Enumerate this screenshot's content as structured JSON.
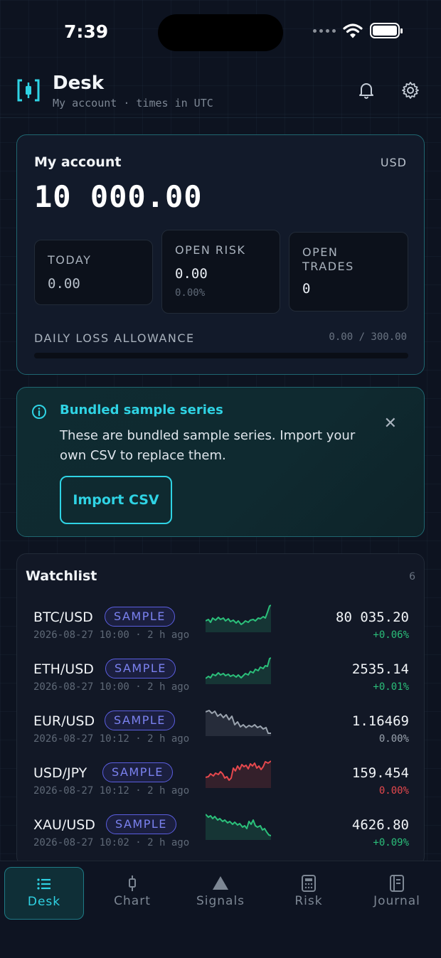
{
  "status_bar": {
    "time": "7:39"
  },
  "header": {
    "title": "Desk",
    "subtitle": "My account · times in UTC",
    "icons": [
      "bell-icon",
      "gear-icon"
    ]
  },
  "account": {
    "title": "My account",
    "currency": "USD",
    "balance": "10 000.00",
    "today": {
      "label": "TODAY",
      "value": "0.00"
    },
    "open_risk": {
      "label": "OPEN RISK",
      "value": "0.00",
      "sub": "0.00%"
    },
    "open_trades": {
      "label": "OPEN TRADES",
      "value": "0"
    },
    "daily_loss": {
      "label": "DAILY LOSS ALLOWANCE",
      "value": "0.00 / 300.00",
      "used_fraction": 0
    }
  },
  "banner": {
    "title": "Bundled sample series",
    "text": "These are bundled sample series. Import your own CSV to replace them.",
    "button": "Import CSV",
    "close": "✕"
  },
  "watchlist": {
    "title": "Watchlist",
    "count": "6",
    "badge": "SAMPLE",
    "items": [
      {
        "symbol": "BTC/USD",
        "timestamp": "2026-08-27 10:00 · 2 h ago",
        "price": "80 035.20",
        "change": "+0.06%",
        "direction": "up"
      },
      {
        "symbol": "ETH/USD",
        "timestamp": "2026-08-27 10:00 · 2 h ago",
        "price": "2535.14",
        "change": "+0.01%",
        "direction": "up"
      },
      {
        "symbol": "EUR/USD",
        "timestamp": "2026-08-27 10:12 · 2 h ago",
        "price": "1.16469",
        "change": "0.00%",
        "direction": "flat"
      },
      {
        "symbol": "USD/JPY",
        "timestamp": "2026-08-27 10:12 · 2 h ago",
        "price": "159.454",
        "change": "0.00%",
        "direction": "down"
      },
      {
        "symbol": "XAU/USD",
        "timestamp": "2026-08-27 10:02 · 2 h ago",
        "price": "4626.80",
        "change": "+0.09%",
        "direction": "up"
      }
    ]
  },
  "colors": {
    "accent": "#2fd3e4",
    "up": "#2bbf7a",
    "down": "#e5484d",
    "flat": "#9aa3ae",
    "badge": "#7b82f0"
  },
  "nav": {
    "items": [
      {
        "label": "Desk",
        "icon": "list-icon",
        "active": true
      },
      {
        "label": "Chart",
        "icon": "candle-icon",
        "active": false
      },
      {
        "label": "Signals",
        "icon": "triangle-icon",
        "active": false
      },
      {
        "label": "Risk",
        "icon": "calculator-icon",
        "active": false
      },
      {
        "label": "Journal",
        "icon": "journal-icon",
        "active": false
      }
    ]
  }
}
